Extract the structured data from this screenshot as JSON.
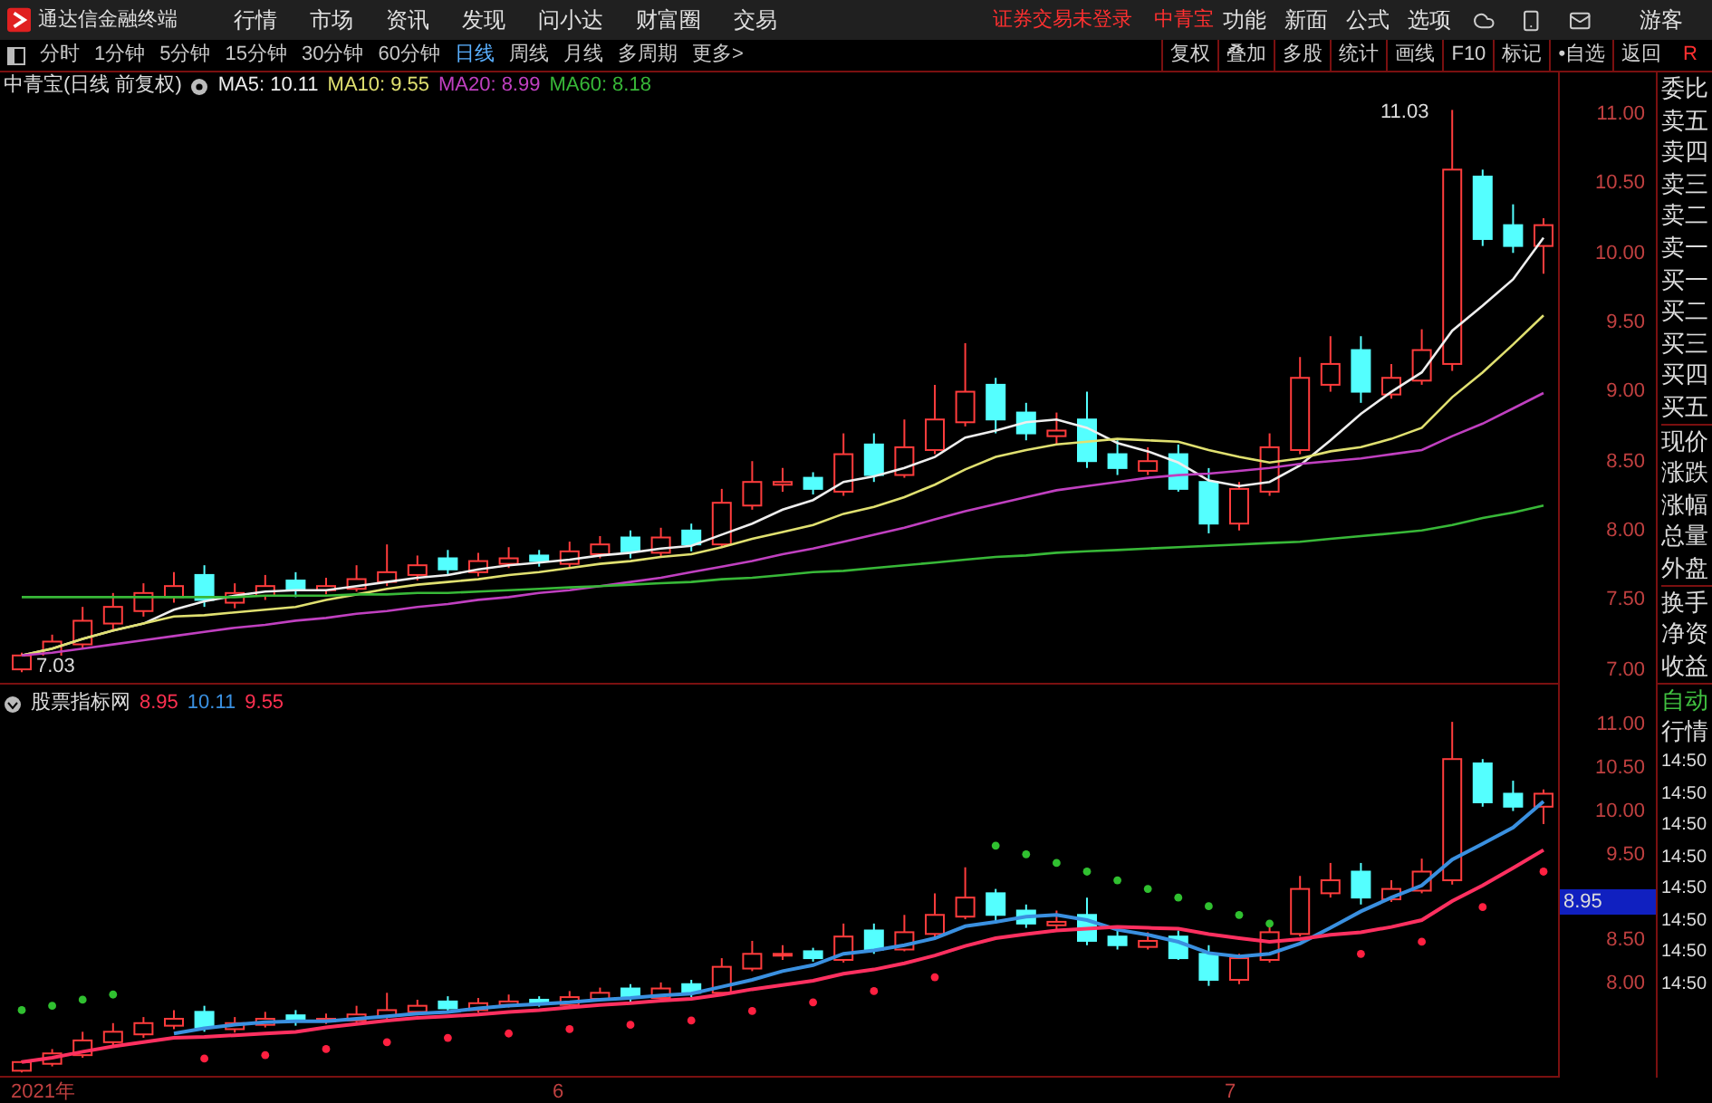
{
  "title_bar": {
    "app_name": "通达信金融终端",
    "menu": [
      "行情",
      "市场",
      "资讯",
      "发现",
      "问小达",
      "财富圈",
      "交易"
    ],
    "notice": "证券交易未登录",
    "stock": "中青宝",
    "tools": [
      "功能",
      "新面",
      "公式",
      "选项"
    ],
    "user": "游客"
  },
  "toolbar": {
    "periods": [
      {
        "label": "分时",
        "selected": false
      },
      {
        "label": "1分钟",
        "selected": false
      },
      {
        "label": "5分钟",
        "selected": false
      },
      {
        "label": "15分钟",
        "selected": false
      },
      {
        "label": "30分钟",
        "selected": false
      },
      {
        "label": "60分钟",
        "selected": false
      },
      {
        "label": "日线",
        "selected": true
      },
      {
        "label": "周线",
        "selected": false
      },
      {
        "label": "月线",
        "selected": false
      },
      {
        "label": "多周期",
        "selected": false
      },
      {
        "label": "更多>",
        "selected": false
      }
    ],
    "actions": [
      "复权",
      "叠加",
      "多股",
      "统计",
      "画线",
      "F10",
      "标记",
      "•自选",
      "返回"
    ],
    "corner": "R"
  },
  "main_chart": {
    "title": "中青宝(日线 前复权)",
    "indicator_values": [
      "10.11",
      "9.55",
      "8.99",
      "8.18"
    ],
    "high_label": "11.03",
    "low_label": "7.03",
    "chart_data": {
      "type": "candlestick",
      "ylim": [
        6.89,
        11.3
      ],
      "yticks": [
        {
          "value": 11,
          "label": "11.00"
        },
        {
          "value": 10.5,
          "label": "10.50"
        },
        {
          "value": 10,
          "label": "10.00"
        },
        {
          "value": 9.5,
          "label": "9.50"
        },
        {
          "value": 9,
          "label": "9.00"
        },
        {
          "value": 8.5,
          "label": "8.50"
        },
        {
          "value": 8,
          "label": "8.00"
        },
        {
          "value": 7.5,
          "label": "7.50"
        },
        {
          "value": 7,
          "label": "7.00"
        }
      ],
      "ohlc": [
        [
          7.0,
          7.12,
          6.98,
          7.1
        ],
        [
          7.08,
          7.25,
          7.05,
          7.2
        ],
        [
          7.18,
          7.45,
          7.15,
          7.35
        ],
        [
          7.33,
          7.55,
          7.28,
          7.45
        ],
        [
          7.42,
          7.62,
          7.38,
          7.55
        ],
        [
          7.52,
          7.7,
          7.48,
          7.6
        ],
        [
          7.68,
          7.75,
          7.45,
          7.5
        ],
        [
          7.48,
          7.62,
          7.44,
          7.55
        ],
        [
          7.53,
          7.68,
          7.5,
          7.6
        ],
        [
          7.64,
          7.7,
          7.52,
          7.58
        ],
        [
          7.57,
          7.66,
          7.54,
          7.6
        ],
        [
          7.58,
          7.75,
          7.56,
          7.65
        ],
        [
          7.63,
          7.9,
          7.6,
          7.7
        ],
        [
          7.68,
          7.82,
          7.64,
          7.75
        ],
        [
          7.8,
          7.86,
          7.68,
          7.72
        ],
        [
          7.7,
          7.84,
          7.67,
          7.78
        ],
        [
          7.76,
          7.88,
          7.73,
          7.8
        ],
        [
          7.82,
          7.86,
          7.74,
          7.78
        ],
        [
          7.76,
          7.92,
          7.73,
          7.85
        ],
        [
          7.83,
          7.96,
          7.8,
          7.9
        ],
        [
          7.95,
          8.0,
          7.8,
          7.85
        ],
        [
          7.84,
          8.02,
          7.81,
          7.95
        ],
        [
          8.0,
          8.05,
          7.85,
          7.9
        ],
        [
          7.9,
          8.3,
          7.88,
          8.2
        ],
        [
          8.18,
          8.5,
          8.15,
          8.35
        ],
        [
          8.33,
          8.45,
          8.28,
          8.35
        ],
        [
          8.38,
          8.42,
          8.26,
          8.3
        ],
        [
          8.28,
          8.7,
          8.25,
          8.55
        ],
        [
          8.62,
          8.7,
          8.35,
          8.4
        ],
        [
          8.4,
          8.8,
          8.38,
          8.6
        ],
        [
          8.58,
          9.05,
          8.55,
          8.8
        ],
        [
          8.78,
          9.35,
          8.75,
          9.0
        ],
        [
          9.05,
          9.1,
          8.7,
          8.8
        ],
        [
          8.85,
          8.92,
          8.65,
          8.7
        ],
        [
          8.68,
          8.85,
          8.62,
          8.72
        ],
        [
          8.8,
          9.0,
          8.45,
          8.5
        ],
        [
          8.55,
          8.65,
          8.4,
          8.45
        ],
        [
          8.43,
          8.6,
          8.4,
          8.5
        ],
        [
          8.55,
          8.62,
          8.28,
          8.3
        ],
        [
          8.35,
          8.45,
          7.98,
          8.05
        ],
        [
          8.05,
          8.35,
          8.0,
          8.3
        ],
        [
          8.28,
          8.7,
          8.25,
          8.6
        ],
        [
          8.58,
          9.25,
          8.55,
          9.1
        ],
        [
          9.05,
          9.4,
          9.0,
          9.2
        ],
        [
          9.3,
          9.4,
          8.92,
          9.0
        ],
        [
          8.98,
          9.2,
          8.95,
          9.1
        ],
        [
          9.08,
          9.45,
          9.05,
          9.3
        ],
        [
          9.2,
          11.03,
          9.15,
          10.6
        ],
        [
          10.55,
          10.6,
          10.05,
          10.1
        ],
        [
          10.2,
          10.35,
          10.0,
          10.05
        ],
        [
          10.05,
          10.25,
          9.85,
          10.2
        ]
      ],
      "series": [
        {
          "name": "MA5:",
          "type": "line",
          "color": "#eeeeee",
          "values": [
            7.1,
            7.15,
            7.22,
            7.28,
            7.33,
            7.43,
            7.49,
            7.53,
            7.56,
            7.57,
            7.57,
            7.6,
            7.63,
            7.66,
            7.68,
            7.72,
            7.75,
            7.77,
            7.79,
            7.82,
            7.84,
            7.87,
            7.89,
            7.97,
            8.05,
            8.15,
            8.22,
            8.35,
            8.39,
            8.45,
            8.53,
            8.67,
            8.72,
            8.78,
            8.8,
            8.74,
            8.63,
            8.57,
            8.49,
            8.36,
            8.32,
            8.35,
            8.47,
            8.65,
            8.84,
            9.0,
            9.14,
            9.44,
            9.62,
            9.81,
            10.11
          ]
        },
        {
          "name": "MA10:",
          "type": "line",
          "color": "#e0e070",
          "values": [
            7.1,
            7.15,
            7.22,
            7.28,
            7.33,
            7.38,
            7.39,
            7.41,
            7.43,
            7.45,
            7.5,
            7.54,
            7.58,
            7.61,
            7.63,
            7.65,
            7.68,
            7.7,
            7.73,
            7.76,
            7.78,
            7.81,
            7.83,
            7.88,
            7.94,
            7.99,
            8.04,
            8.12,
            8.17,
            8.24,
            8.33,
            8.44,
            8.53,
            8.58,
            8.62,
            8.64,
            8.66,
            8.65,
            8.64,
            8.58,
            8.53,
            8.49,
            8.52,
            8.57,
            8.6,
            8.66,
            8.74,
            8.96,
            9.14,
            9.34,
            9.55
          ]
        },
        {
          "name": "MA20:",
          "type": "line",
          "color": "#c040c0",
          "values": [
            7.1,
            7.12,
            7.15,
            7.18,
            7.21,
            7.24,
            7.27,
            7.3,
            7.32,
            7.35,
            7.37,
            7.4,
            7.42,
            7.45,
            7.47,
            7.5,
            7.52,
            7.55,
            7.57,
            7.6,
            7.63,
            7.66,
            7.7,
            7.74,
            7.78,
            7.83,
            7.87,
            7.92,
            7.97,
            8.02,
            8.08,
            8.14,
            8.19,
            8.24,
            8.29,
            8.32,
            8.35,
            8.38,
            8.4,
            8.41,
            8.43,
            8.45,
            8.48,
            8.5,
            8.52,
            8.55,
            8.58,
            8.68,
            8.77,
            8.88,
            8.99
          ]
        },
        {
          "name": "MA60:",
          "type": "line",
          "color": "#38b838",
          "values": [
            7.52,
            7.52,
            7.52,
            7.52,
            7.52,
            7.52,
            7.52,
            7.52,
            7.53,
            7.53,
            7.53,
            7.54,
            7.54,
            7.55,
            7.55,
            7.56,
            7.57,
            7.58,
            7.59,
            7.6,
            7.61,
            7.62,
            7.63,
            7.65,
            7.66,
            7.68,
            7.7,
            7.71,
            7.73,
            7.75,
            7.77,
            7.79,
            7.81,
            7.82,
            7.84,
            7.85,
            7.86,
            7.87,
            7.88,
            7.89,
            7.9,
            7.91,
            7.92,
            7.94,
            7.96,
            7.98,
            8.0,
            8.04,
            8.09,
            8.13,
            8.18
          ]
        }
      ]
    }
  },
  "quote_panel": {
    "labels": [
      "委比",
      "卖五",
      "卖四",
      "卖三",
      "卖二",
      "卖一",
      "买一",
      "买二",
      "买三",
      "买四",
      "买五",
      "现价",
      "涨跌",
      "涨幅",
      "总量",
      "外盘",
      "换手",
      "净资",
      "收益"
    ]
  },
  "indicator_pane": {
    "title": "股票指标网",
    "current_price": "8.95",
    "values": [
      {
        "label": "8.95",
        "color": "#ff3050"
      },
      {
        "label": "10.11",
        "color": "#3a90e0"
      },
      {
        "label": "9.55",
        "color": "#ff3050"
      }
    ],
    "chart_data": {
      "type": "candlestick",
      "ylim": [
        6.92,
        11.46
      ],
      "yticks": [
        {
          "value": 11,
          "label": "11.00"
        },
        {
          "value": 10.5,
          "label": "10.50"
        },
        {
          "value": 10,
          "label": "10.00"
        },
        {
          "value": 9.5,
          "label": "9.50"
        },
        {
          "value": 8.5,
          "label": "8.50"
        },
        {
          "value": 8,
          "label": "8.00"
        }
      ],
      "ohlc": [
        [
          7.0,
          7.12,
          6.98,
          7.1
        ],
        [
          7.08,
          7.25,
          7.05,
          7.2
        ],
        [
          7.18,
          7.45,
          7.15,
          7.35
        ],
        [
          7.33,
          7.55,
          7.28,
          7.45
        ],
        [
          7.42,
          7.62,
          7.38,
          7.55
        ],
        [
          7.52,
          7.7,
          7.48,
          7.6
        ],
        [
          7.68,
          7.75,
          7.45,
          7.5
        ],
        [
          7.48,
          7.62,
          7.44,
          7.55
        ],
        [
          7.53,
          7.68,
          7.5,
          7.6
        ],
        [
          7.64,
          7.7,
          7.52,
          7.58
        ],
        [
          7.57,
          7.66,
          7.54,
          7.6
        ],
        [
          7.58,
          7.75,
          7.56,
          7.65
        ],
        [
          7.63,
          7.9,
          7.6,
          7.7
        ],
        [
          7.68,
          7.82,
          7.64,
          7.75
        ],
        [
          7.8,
          7.86,
          7.68,
          7.72
        ],
        [
          7.7,
          7.84,
          7.67,
          7.78
        ],
        [
          7.76,
          7.88,
          7.73,
          7.8
        ],
        [
          7.82,
          7.86,
          7.74,
          7.78
        ],
        [
          7.76,
          7.92,
          7.73,
          7.85
        ],
        [
          7.83,
          7.96,
          7.8,
          7.9
        ],
        [
          7.95,
          8.0,
          7.8,
          7.85
        ],
        [
          7.84,
          8.02,
          7.81,
          7.95
        ],
        [
          8.0,
          8.05,
          7.85,
          7.9
        ],
        [
          7.9,
          8.3,
          7.88,
          8.2
        ],
        [
          8.18,
          8.5,
          8.15,
          8.35
        ],
        [
          8.33,
          8.45,
          8.28,
          8.35
        ],
        [
          8.38,
          8.42,
          8.26,
          8.3
        ],
        [
          8.28,
          8.7,
          8.25,
          8.55
        ],
        [
          8.62,
          8.7,
          8.35,
          8.4
        ],
        [
          8.4,
          8.8,
          8.38,
          8.6
        ],
        [
          8.58,
          9.05,
          8.55,
          8.8
        ],
        [
          8.78,
          9.35,
          8.75,
          9.0
        ],
        [
          9.05,
          9.1,
          8.7,
          8.8
        ],
        [
          8.85,
          8.92,
          8.65,
          8.7
        ],
        [
          8.68,
          8.85,
          8.62,
          8.72
        ],
        [
          8.8,
          9.0,
          8.45,
          8.5
        ],
        [
          8.55,
          8.65,
          8.4,
          8.45
        ],
        [
          8.43,
          8.6,
          8.4,
          8.5
        ],
        [
          8.55,
          8.62,
          8.28,
          8.3
        ],
        [
          8.35,
          8.45,
          7.98,
          8.05
        ],
        [
          8.05,
          8.35,
          8.0,
          8.3
        ],
        [
          8.28,
          8.7,
          8.25,
          8.6
        ],
        [
          8.58,
          9.25,
          8.55,
          9.1
        ],
        [
          9.05,
          9.4,
          9.0,
          9.2
        ],
        [
          9.3,
          9.4,
          8.92,
          9.0
        ],
        [
          8.98,
          9.2,
          8.95,
          9.1
        ],
        [
          9.08,
          9.45,
          9.05,
          9.3
        ],
        [
          9.2,
          11.03,
          9.15,
          10.6
        ],
        [
          10.55,
          10.6,
          10.05,
          10.1
        ],
        [
          10.2,
          10.35,
          10.0,
          10.05
        ],
        [
          10.05,
          10.25,
          9.85,
          10.2
        ]
      ],
      "series": [
        {
          "type": "line",
          "color": "#3a90e0",
          "values": [
            null,
            null,
            null,
            null,
            null,
            7.43,
            7.49,
            7.53,
            7.56,
            7.57,
            7.57,
            7.6,
            7.63,
            7.66,
            7.68,
            7.72,
            7.75,
            7.77,
            7.79,
            7.82,
            7.84,
            7.87,
            7.89,
            7.97,
            8.05,
            8.15,
            8.22,
            8.35,
            8.39,
            8.45,
            8.53,
            8.67,
            8.72,
            8.78,
            8.8,
            8.74,
            8.63,
            8.57,
            8.49,
            8.36,
            8.32,
            8.35,
            8.47,
            8.65,
            8.84,
            9.0,
            9.14,
            9.44,
            9.62,
            9.81,
            10.11
          ]
        },
        {
          "type": "line",
          "color": "#ff3060",
          "values": [
            7.1,
            7.15,
            7.22,
            7.28,
            7.33,
            7.38,
            7.39,
            7.41,
            7.43,
            7.45,
            7.5,
            7.54,
            7.58,
            7.61,
            7.63,
            7.65,
            7.68,
            7.7,
            7.73,
            7.76,
            7.78,
            7.81,
            7.83,
            7.88,
            7.94,
            7.99,
            8.04,
            8.12,
            8.17,
            8.24,
            8.33,
            8.44,
            8.53,
            8.58,
            8.62,
            8.64,
            8.66,
            8.65,
            8.64,
            8.58,
            8.53,
            8.49,
            8.52,
            8.57,
            8.6,
            8.66,
            8.74,
            8.96,
            9.14,
            9.34,
            9.55
          ]
        },
        {
          "type": "scatter",
          "color": "#ff2040",
          "values": [
            null,
            null,
            null,
            null,
            null,
            null,
            7.14,
            null,
            7.18,
            null,
            7.25,
            null,
            7.33,
            null,
            7.38,
            null,
            7.43,
            null,
            7.48,
            null,
            7.53,
            null,
            7.58,
            null,
            7.69,
            null,
            7.79,
            null,
            7.92,
            null,
            8.08,
            null,
            null,
            null,
            null,
            null,
            null,
            null,
            null,
            null,
            null,
            null,
            null,
            null,
            8.35,
            null,
            8.49,
            null,
            8.89,
            null,
            9.3
          ]
        },
        {
          "type": "scatter",
          "color": "#30c030",
          "values": [
            7.7,
            7.75,
            7.82,
            7.88,
            null,
            null,
            null,
            null,
            null,
            null,
            null,
            null,
            null,
            null,
            null,
            null,
            null,
            null,
            null,
            null,
            null,
            null,
            null,
            null,
            null,
            null,
            null,
            null,
            null,
            null,
            null,
            null,
            9.6,
            9.5,
            9.4,
            9.3,
            9.2,
            9.1,
            9.0,
            8.9,
            8.8,
            8.7,
            null,
            null,
            null,
            null,
            null,
            null,
            null,
            null,
            null
          ]
        }
      ]
    }
  },
  "tick_panel": {
    "header": [
      "自动",
      "行情"
    ],
    "times": [
      "14:50",
      "14:50",
      "14:50",
      "14:50",
      "14:50",
      "14:50",
      "14:50",
      "14:50"
    ]
  },
  "date_axis": [
    "2021年",
    "6",
    "7"
  ]
}
